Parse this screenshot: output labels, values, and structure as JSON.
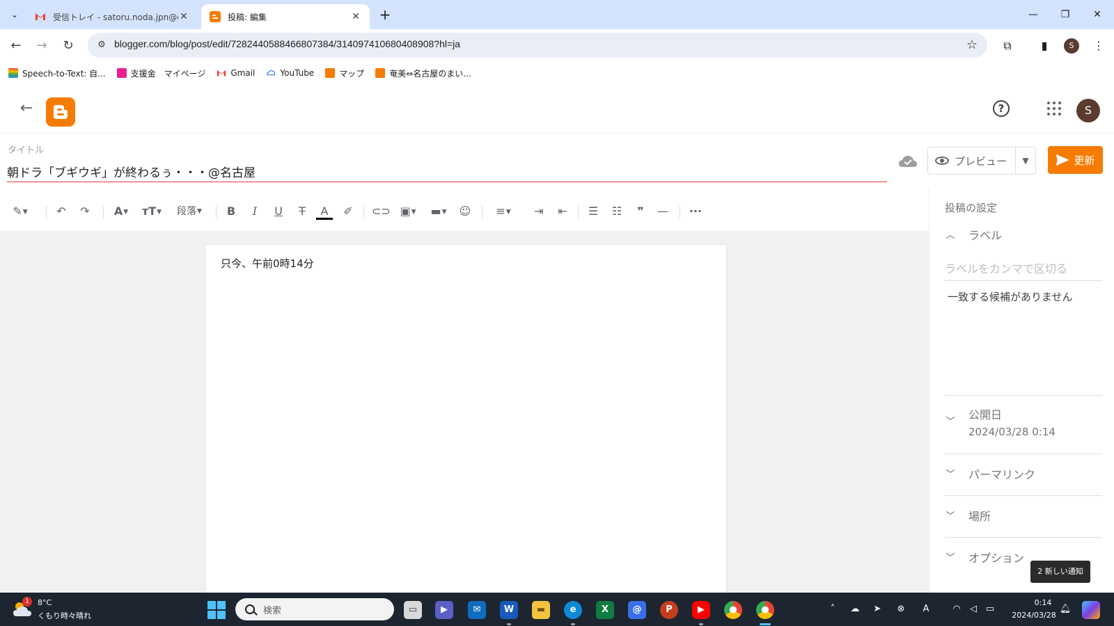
{
  "browser": {
    "tabs": [
      {
        "title": "受信トレイ - satoru.noda.jpn@gmail.com",
        "close": "✕"
      },
      {
        "title": "投稿: 編集",
        "close": "✕"
      }
    ],
    "new_tab": "+",
    "url": "blogger.com/blog/post/edit/7282440588466807384/3140974106804089​08?hl=ja",
    "profile_initial": "S",
    "bookmarks": [
      {
        "label": "Speech-to-Text: 自...",
        "color": "#e8453c"
      },
      {
        "label": "支援金　マイページ",
        "color": "#e91e8c"
      },
      {
        "label": "Gmail",
        "color": "#ea4335"
      },
      {
        "label": "YouTube",
        "color": "#4285f4"
      },
      {
        "label": "マップ",
        "color": "#f57c00"
      },
      {
        "label": "奄美⇔名古屋のまい...",
        "color": "#f57c00"
      }
    ]
  },
  "app": {
    "avatar_initial": "S",
    "title_label": "タイトル",
    "post_title": "朝ドラ「ブギウギ」が終わるぅ・・・@名古屋",
    "preview_label": "プレビュー",
    "update_label": "更新",
    "toolbar": {
      "paragraph_label": "段落"
    },
    "body_text": "只今、午前0時14分"
  },
  "settings": {
    "heading": "投稿の設定",
    "labels_title": "ラベル",
    "labels_placeholder": "ラベルをカンマで区切る",
    "no_match": "一致する候補がありません",
    "publish_title": "公開日",
    "publish_value": "2024/03/28 0:14",
    "permalink_title": "パーマリンク",
    "location_title": "場所",
    "options_title": "オプション"
  },
  "notification": {
    "text": "2 新しい通知"
  },
  "taskbar": {
    "weather_temp": "8°C",
    "weather_desc": "くもり時々晴れ",
    "weather_badge": "1",
    "search_placeholder": "検索",
    "time": "0:14",
    "date": "2024/03/28"
  },
  "colors": {
    "blogger_orange": "#f57c00",
    "title_underline": "#e53935",
    "tab_strip": "#d3e3fd",
    "taskbar": "#1c2530"
  }
}
